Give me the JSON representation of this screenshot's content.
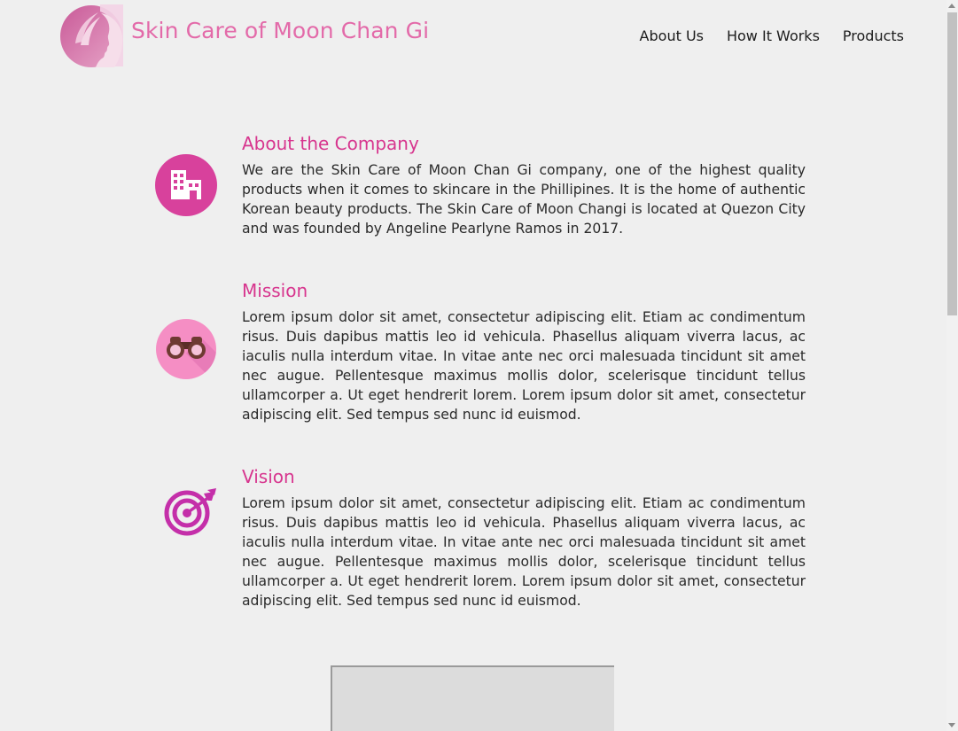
{
  "header": {
    "brand": "Skin Care of Moon Chan Gi",
    "nav": [
      "About Us",
      "How It Works",
      "Products"
    ]
  },
  "sections": [
    {
      "title": "About the Company",
      "body": "We are the Skin Care of Moon Chan Gi company, one of the highest quality products when it comes to skincare in the Phillipines. It is the home of authentic Korean beauty products. The Skin Care of Moon Changi is located at Quezon City and was founded by Angeline Pearlyne Ramos in 2017.",
      "icon": "building-icon"
    },
    {
      "title": "Mission",
      "body": "Lorem ipsum dolor sit amet, consectetur adipiscing elit. Etiam ac condimentum risus. Duis dapibus mattis leo id vehicula. Phasellus aliquam viverra lacus, ac iaculis nulla interdum vitae. In vitae ante nec orci malesuada tincidunt sit amet nec augue. Pellentesque maximus mollis dolor, scelerisque tincidunt tellus ullamcorper a. Ut eget hendrerit lorem. Lorem ipsum dolor sit amet, consectetur adipiscing elit. Sed tempus sed nunc id euismod.",
      "icon": "binoculars-icon"
    },
    {
      "title": "Vision",
      "body": "Lorem ipsum dolor sit amet, consectetur adipiscing elit. Etiam ac condimentum risus. Duis dapibus mattis leo id vehicula. Phasellus aliquam viverra lacus, ac iaculis nulla interdum vitae. In vitae ante nec orci malesuada tincidunt sit amet nec augue. Pellentesque maximus mollis dolor, scelerisque tincidunt tellus ullamcorper a. Ut eget hendrerit lorem. Lorem ipsum dolor sit amet, consectetur adipiscing elit. Sed tempus sed nunc id euismod.",
      "icon": "target-icon"
    }
  ],
  "colors": {
    "brand_pink": "#e36aa9",
    "heading_pink": "#d7358e",
    "background": "#efefef"
  }
}
